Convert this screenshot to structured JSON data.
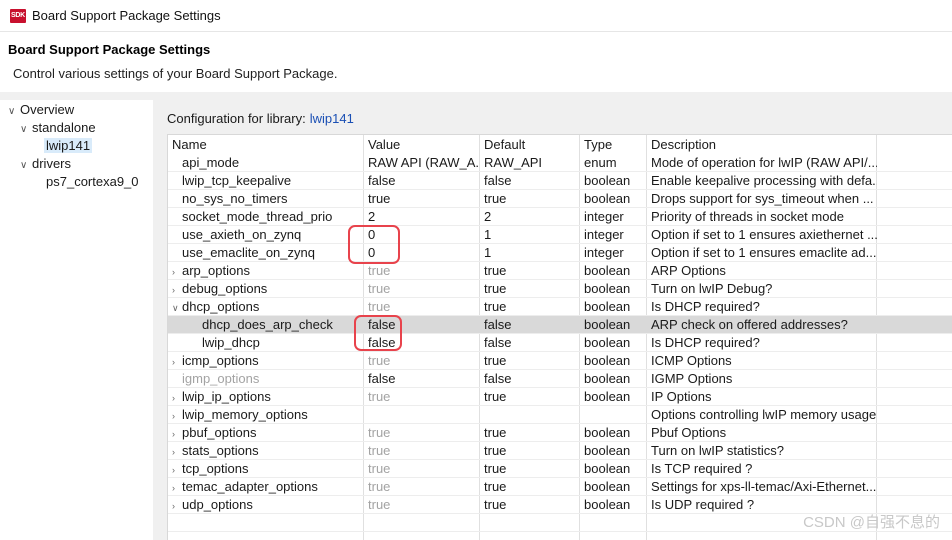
{
  "window": {
    "logo": "SDK",
    "title": "Board Support Package Settings"
  },
  "header": {
    "title": "Board Support Package Settings",
    "subtitle": "Control various settings of your Board Support Package."
  },
  "sidebar": {
    "items": [
      {
        "label": "Overview"
      },
      {
        "label": "standalone"
      },
      {
        "label": "lwip141"
      },
      {
        "label": "drivers"
      },
      {
        "label": "ps7_cortexa9_0"
      }
    ]
  },
  "config": {
    "label": "Configuration for library:",
    "library": "lwip141"
  },
  "table": {
    "columns": [
      "Name",
      "Value",
      "Default",
      "Type",
      "Description"
    ],
    "rows": [
      {
        "name": "api_mode",
        "value": "RAW API (RAW_A...",
        "default": "RAW_API",
        "type": "enum",
        "description": "Mode of operation for lwIP (RAW API/..."
      },
      {
        "name": "lwip_tcp_keepalive",
        "value": "false",
        "default": "false",
        "type": "boolean",
        "description": "Enable keepalive processing with defa..."
      },
      {
        "name": "no_sys_no_timers",
        "value": "true",
        "default": "true",
        "type": "boolean",
        "description": "Drops support for sys_timeout when ..."
      },
      {
        "name": "socket_mode_thread_prio",
        "value": "2",
        "default": "2",
        "type": "integer",
        "description": "Priority of threads in socket mode"
      },
      {
        "name": "use_axieth_on_zynq",
        "value": "0",
        "default": "1",
        "type": "integer",
        "description": "Option if set to 1 ensures axiethernet ..."
      },
      {
        "name": "use_emaclite_on_zynq",
        "value": "0",
        "default": "1",
        "type": "integer",
        "description": "Option if set to 1 ensures emaclite ad..."
      },
      {
        "name": "arp_options",
        "value": "true",
        "default": "true",
        "type": "boolean",
        "description": "ARP Options"
      },
      {
        "name": "debug_options",
        "value": "true",
        "default": "true",
        "type": "boolean",
        "description": "Turn on lwIP Debug?"
      },
      {
        "name": "dhcp_options",
        "value": "true",
        "default": "true",
        "type": "boolean",
        "description": "Is DHCP required?"
      },
      {
        "name": "dhcp_does_arp_check",
        "value": "false",
        "default": "false",
        "type": "boolean",
        "description": "ARP check on offered addresses?"
      },
      {
        "name": "lwip_dhcp",
        "value": "false",
        "default": "false",
        "type": "boolean",
        "description": "Is DHCP required?"
      },
      {
        "name": "icmp_options",
        "value": "true",
        "default": "true",
        "type": "boolean",
        "description": "ICMP Options"
      },
      {
        "name": "igmp_options",
        "value": "false",
        "default": "false",
        "type": "boolean",
        "description": "IGMP Options"
      },
      {
        "name": "lwip_ip_options",
        "value": "true",
        "default": "true",
        "type": "boolean",
        "description": "IP Options"
      },
      {
        "name": "lwip_memory_options",
        "value": "",
        "default": "",
        "type": "",
        "description": "Options controlling lwIP memory usage"
      },
      {
        "name": "pbuf_options",
        "value": "true",
        "default": "true",
        "type": "boolean",
        "description": "Pbuf Options"
      },
      {
        "name": "stats_options",
        "value": "true",
        "default": "true",
        "type": "boolean",
        "description": "Turn on lwIP statistics?"
      },
      {
        "name": "tcp_options",
        "value": "true",
        "default": "true",
        "type": "boolean",
        "description": "Is TCP required ?"
      },
      {
        "name": "temac_adapter_options",
        "value": "true",
        "default": "true",
        "type": "boolean",
        "description": "Settings for xps-ll-temac/Axi-Ethernet..."
      },
      {
        "name": "udp_options",
        "value": "true",
        "default": "true",
        "type": "boolean",
        "description": "Is UDP required ?"
      }
    ]
  },
  "watermark": "CSDN @自强不息的",
  "colors": {
    "selection": "#d9d9d9",
    "accent_link": "#1a4fb4",
    "annotation": "#e8434c",
    "muted_text": "#a3a3a3"
  }
}
